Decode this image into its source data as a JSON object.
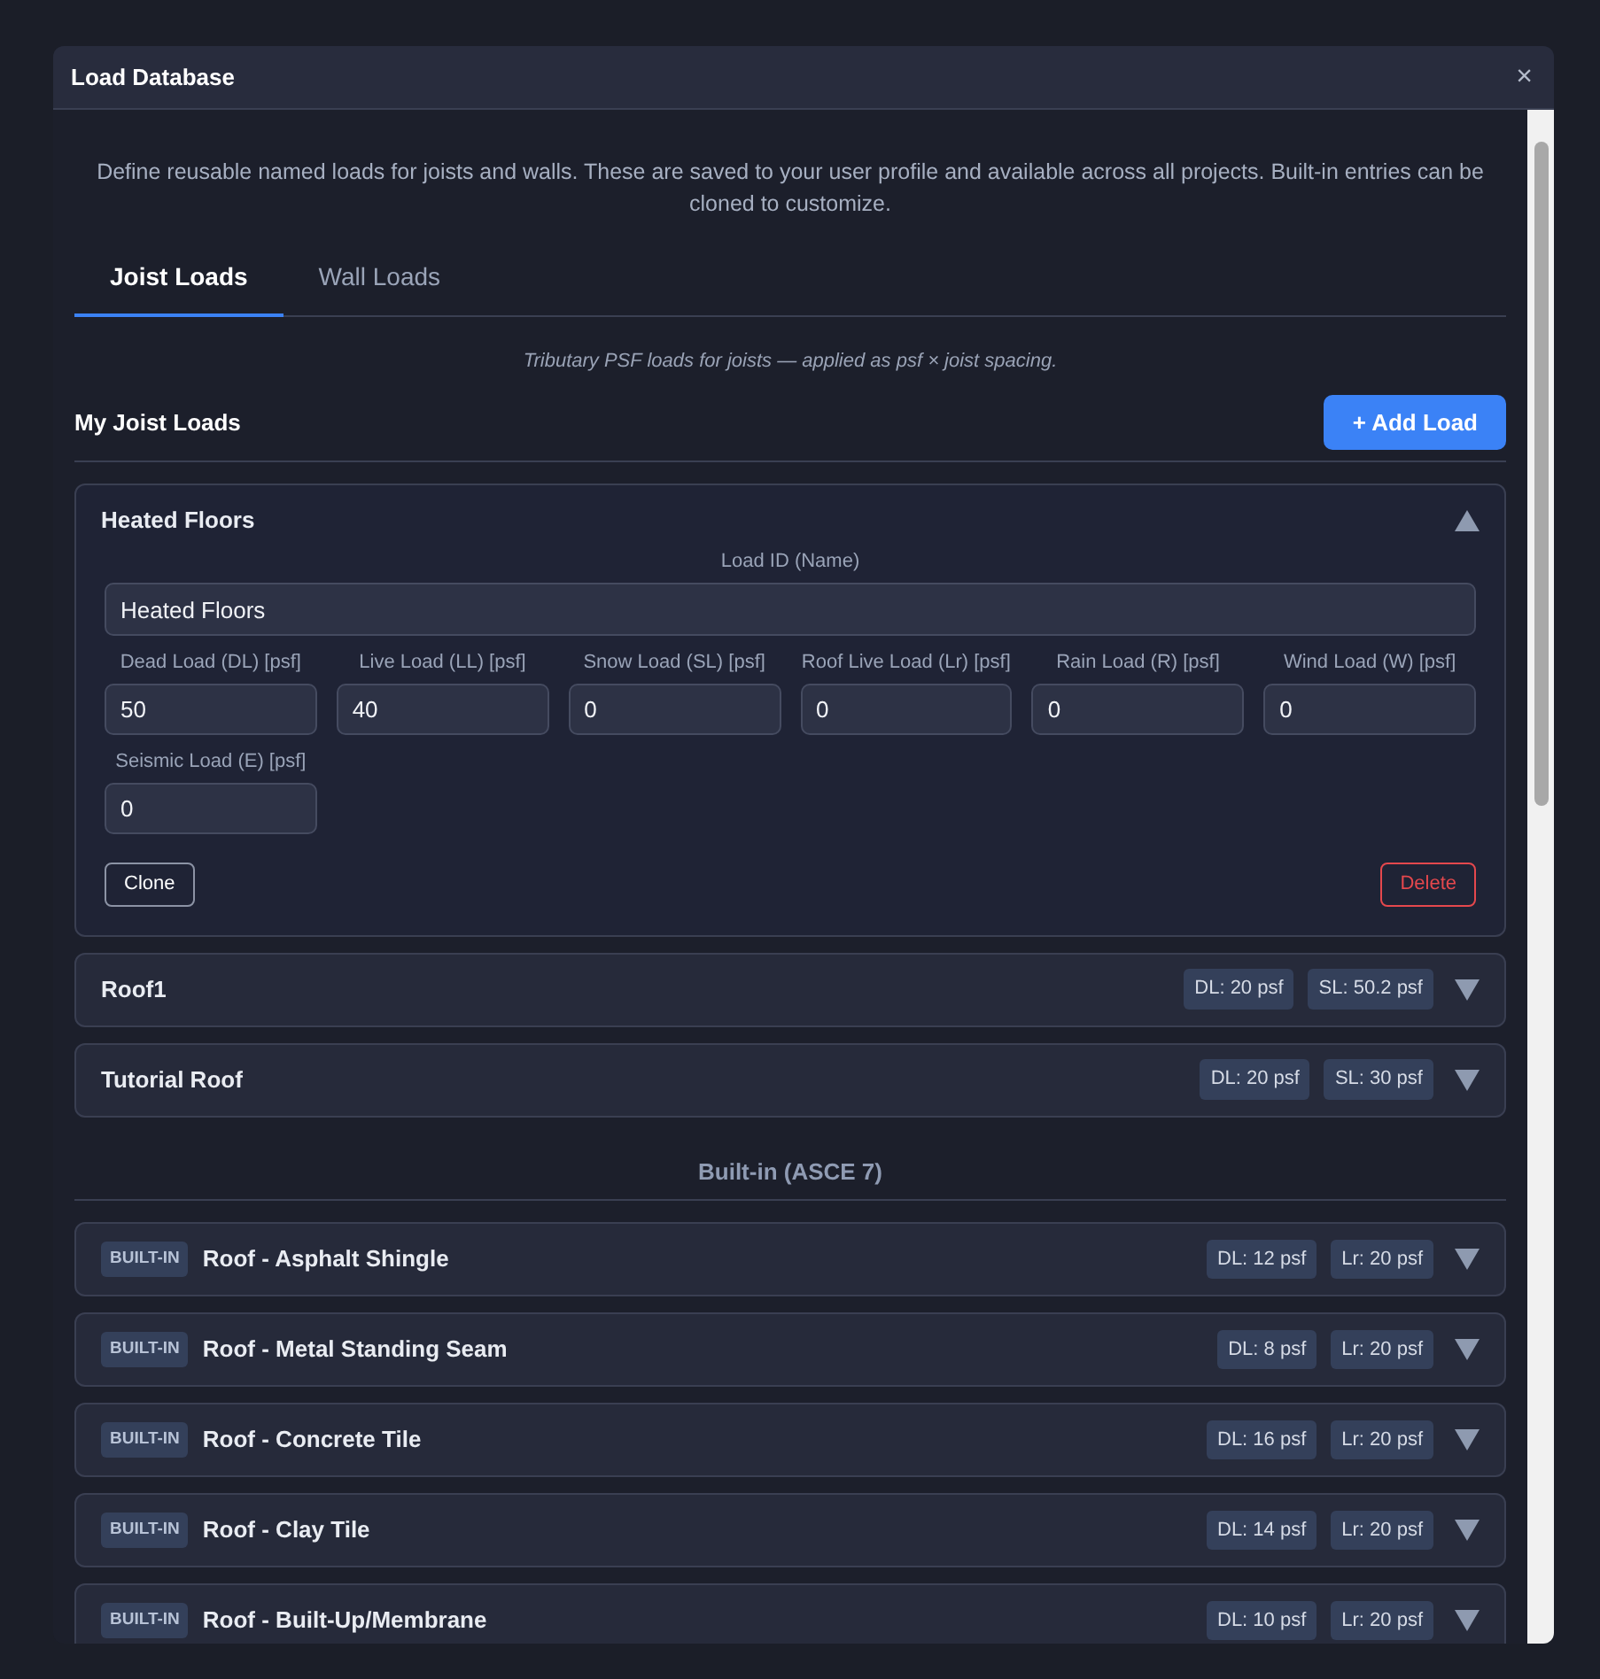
{
  "window": {
    "title": "Load Database",
    "close": "×"
  },
  "description": "Define reusable named loads for joists and walls. These are saved to your user profile and available across all projects. Built-in entries can be cloned to customize.",
  "tabs": [
    {
      "label": "Joist Loads",
      "selected": true
    },
    {
      "label": "Wall Loads",
      "selected": false
    }
  ],
  "hint": "Tributary PSF loads for joists — applied as psf × joist spacing.",
  "my_loads": {
    "title": "My Joist Loads",
    "add_button": "+ Add Load",
    "items": [
      {
        "name": "Heated Floors",
        "expanded": true,
        "id_label": "Load ID (Name)",
        "id_value": "Heated Floors",
        "fields": [
          {
            "label": "Dead Load (DL) [psf]",
            "value": "50"
          },
          {
            "label": "Live Load (LL) [psf]",
            "value": "40"
          },
          {
            "label": "Snow Load (SL) [psf]",
            "value": "0"
          },
          {
            "label": "Roof Live Load (Lr) [psf]",
            "value": "0"
          },
          {
            "label": "Rain Load (R) [psf]",
            "value": "0"
          },
          {
            "label": "Wind Load (W) [psf]",
            "value": "0"
          },
          {
            "label": "Seismic Load (E) [psf]",
            "value": "0"
          }
        ],
        "clone": "Clone",
        "delete": "Delete"
      },
      {
        "name": "Roof1",
        "expanded": false,
        "tags": [
          "DL: 20 psf",
          "SL: 50.2 psf"
        ]
      },
      {
        "name": "Tutorial Roof",
        "expanded": false,
        "tags": [
          "DL: 20 psf",
          "SL: 30 psf"
        ]
      }
    ]
  },
  "builtin": {
    "title": "Built-in (ASCE 7)",
    "items": [
      {
        "badge": "BUILT-IN",
        "name": "Roof - Asphalt Shingle",
        "expanded": false,
        "tags": [
          "DL: 12 psf",
          "Lr: 20 psf"
        ]
      },
      {
        "badge": "BUILT-IN",
        "name": "Roof - Metal Standing Seam",
        "expanded": false,
        "tags": [
          "DL: 8 psf",
          "Lr: 20 psf"
        ]
      },
      {
        "badge": "BUILT-IN",
        "name": "Roof - Concrete Tile",
        "expanded": false,
        "tags": [
          "DL: 16 psf",
          "Lr: 20 psf"
        ]
      },
      {
        "badge": "BUILT-IN",
        "name": "Roof - Clay Tile",
        "expanded": false,
        "tags": [
          "DL: 14 psf",
          "Lr: 20 psf"
        ]
      },
      {
        "badge": "BUILT-IN",
        "name": "Roof - Built-Up/Membrane",
        "expanded": false,
        "tags": [
          "DL: 10 psf",
          "Lr: 20 psf"
        ]
      }
    ]
  }
}
